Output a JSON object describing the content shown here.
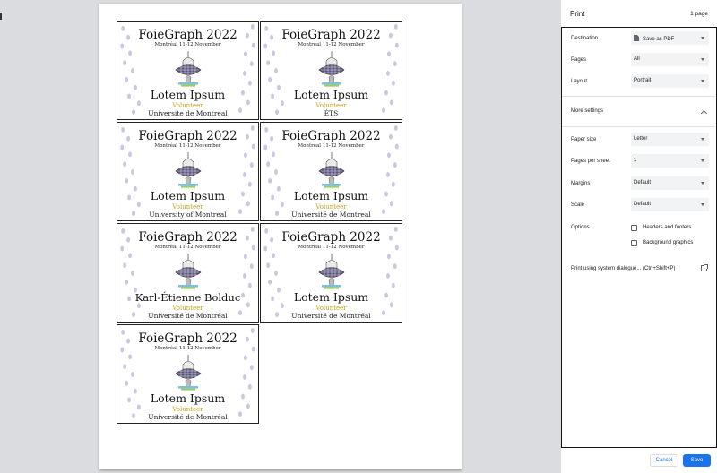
{
  "badges": [
    {
      "title": "FoieGraph 2022",
      "date": "Montréal 11-12 November",
      "name": "Lotem Ipsum",
      "role": "Volunteer",
      "uni": "Universite de Montreal"
    },
    {
      "title": "FoieGraph 2022",
      "date": "Montréal 11-12 November",
      "name": "Lotem Ipsum",
      "role": "Volunteer",
      "uni": "ÉTS"
    },
    {
      "title": "FoieGraph 2022",
      "date": "Montréal 11-12 November",
      "name": "Lotem Ipsum",
      "role": "Volunteer",
      "uni": "University of Montreal"
    },
    {
      "title": "FoieGraph 2022",
      "date": "Montréal 11-12 November",
      "name": "Lotem Ipsum",
      "role": "Volunteer",
      "uni": "Université de Montreal"
    },
    {
      "title": "FoieGraph 2022",
      "date": "Montréal 11-12 November",
      "name": "Karl-Étienne Bolduc",
      "role": "Volunteer",
      "uni": "Université de Montréal"
    },
    {
      "title": "FoieGraph 2022",
      "date": "Montréal 11-12 November",
      "name": "Lotem Ipsum",
      "role": "Volunteer",
      "uni": "Université de Montréal"
    },
    {
      "title": "FoieGraph 2022",
      "date": "Montréal 11-12 November",
      "name": "Lotem Ipsum",
      "role": "Volunteer",
      "uni": "Université de Montréal"
    }
  ],
  "print": {
    "title": "Print",
    "page_count": "1 page",
    "destination": {
      "label": "Destination",
      "value": "Save as PDF"
    },
    "pages": {
      "label": "Pages",
      "value": "All"
    },
    "layout": {
      "label": "Layout",
      "value": "Portrait"
    },
    "more_settings": "More settings",
    "paper_size": {
      "label": "Paper size",
      "value": "Letter"
    },
    "pages_per_sheet": {
      "label": "Pages per sheet",
      "value": "1"
    },
    "margins": {
      "label": "Margins",
      "value": "Default"
    },
    "scale": {
      "label": "Scale",
      "value": "Default"
    },
    "options": {
      "label": "Options",
      "headers_footers": "Headers and footers",
      "background_graphics": "Background graphics"
    },
    "system_dialog": "Print using system dialogue... (Ctrl+Shift+P)",
    "cancel": "Cancel",
    "save": "Save"
  },
  "colors": {
    "accent": "#1a73e8",
    "volunteer": "#c9a21b",
    "preview_bg": "#dadce0"
  }
}
